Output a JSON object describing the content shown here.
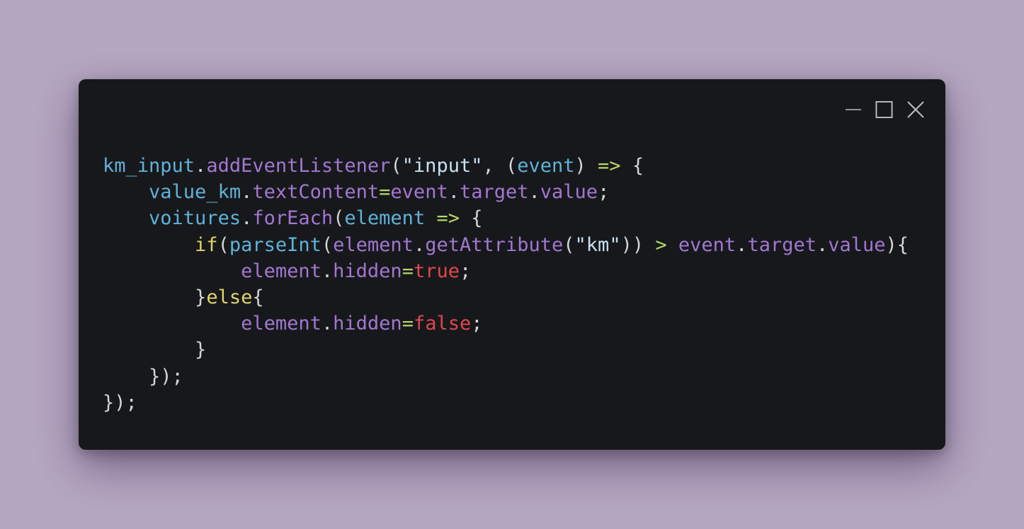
{
  "window": {
    "controls": [
      {
        "name": "minimize-icon"
      },
      {
        "name": "maximize-icon"
      },
      {
        "name": "close-icon"
      }
    ]
  },
  "colors": {
    "background": "#b5a6c1",
    "window_bg": "#17181b",
    "plain": "#d4d4d4",
    "variable": "#5fb3d9",
    "property": "#a277d1",
    "string": "#c8e0f2",
    "operator": "#b5d66a",
    "keyword": "#e2d36a",
    "boolean": "#e0474f"
  },
  "code": {
    "lines": [
      [
        {
          "text": "km_input",
          "kind": "variable"
        },
        {
          "text": ".",
          "kind": "plain"
        },
        {
          "text": "addEventListener",
          "kind": "property"
        },
        {
          "text": "(",
          "kind": "plain"
        },
        {
          "text": "\"input\"",
          "kind": "string"
        },
        {
          "text": ", (",
          "kind": "plain"
        },
        {
          "text": "event",
          "kind": "variable"
        },
        {
          "text": ") ",
          "kind": "plain"
        },
        {
          "text": "=>",
          "kind": "operator"
        },
        {
          "text": " {",
          "kind": "plain"
        }
      ],
      [
        {
          "text": "    ",
          "kind": "plain"
        },
        {
          "text": "value_km",
          "kind": "variable"
        },
        {
          "text": ".",
          "kind": "plain"
        },
        {
          "text": "textContent",
          "kind": "property"
        },
        {
          "text": "=",
          "kind": "operator"
        },
        {
          "text": "event",
          "kind": "property"
        },
        {
          "text": ".",
          "kind": "plain"
        },
        {
          "text": "target",
          "kind": "property"
        },
        {
          "text": ".",
          "kind": "plain"
        },
        {
          "text": "value",
          "kind": "property"
        },
        {
          "text": ";",
          "kind": "plain"
        }
      ],
      [
        {
          "text": "    ",
          "kind": "plain"
        },
        {
          "text": "voitures",
          "kind": "variable"
        },
        {
          "text": ".",
          "kind": "plain"
        },
        {
          "text": "forEach",
          "kind": "property"
        },
        {
          "text": "(",
          "kind": "plain"
        },
        {
          "text": "element",
          "kind": "variable"
        },
        {
          "text": " ",
          "kind": "plain"
        },
        {
          "text": "=>",
          "kind": "operator"
        },
        {
          "text": " {",
          "kind": "plain"
        }
      ],
      [
        {
          "text": "        ",
          "kind": "plain"
        },
        {
          "text": "if",
          "kind": "keyword"
        },
        {
          "text": "(",
          "kind": "plain"
        },
        {
          "text": "parseInt",
          "kind": "variable"
        },
        {
          "text": "(",
          "kind": "plain"
        },
        {
          "text": "element",
          "kind": "property"
        },
        {
          "text": ".",
          "kind": "plain"
        },
        {
          "text": "getAttribute",
          "kind": "property"
        },
        {
          "text": "(",
          "kind": "plain"
        },
        {
          "text": "\"km\"",
          "kind": "string"
        },
        {
          "text": ")) ",
          "kind": "plain"
        },
        {
          "text": ">",
          "kind": "operator"
        },
        {
          "text": " ",
          "kind": "plain"
        },
        {
          "text": "event",
          "kind": "property"
        },
        {
          "text": ".",
          "kind": "plain"
        },
        {
          "text": "target",
          "kind": "property"
        },
        {
          "text": ".",
          "kind": "plain"
        },
        {
          "text": "value",
          "kind": "property"
        },
        {
          "text": "){",
          "kind": "plain"
        }
      ],
      [
        {
          "text": "            ",
          "kind": "plain"
        },
        {
          "text": "element",
          "kind": "property"
        },
        {
          "text": ".",
          "kind": "plain"
        },
        {
          "text": "hidden",
          "kind": "property"
        },
        {
          "text": "=",
          "kind": "operator"
        },
        {
          "text": "true",
          "kind": "boolean"
        },
        {
          "text": ";",
          "kind": "plain"
        }
      ],
      [
        {
          "text": "        ",
          "kind": "plain"
        },
        {
          "text": "}",
          "kind": "plain"
        },
        {
          "text": "else",
          "kind": "keyword"
        },
        {
          "text": "{",
          "kind": "plain"
        }
      ],
      [
        {
          "text": "            ",
          "kind": "plain"
        },
        {
          "text": "element",
          "kind": "property"
        },
        {
          "text": ".",
          "kind": "plain"
        },
        {
          "text": "hidden",
          "kind": "property"
        },
        {
          "text": "=",
          "kind": "operator"
        },
        {
          "text": "false",
          "kind": "boolean"
        },
        {
          "text": ";",
          "kind": "plain"
        }
      ],
      [
        {
          "text": "        ",
          "kind": "plain"
        },
        {
          "text": "}",
          "kind": "plain"
        }
      ],
      [
        {
          "text": "    ",
          "kind": "plain"
        },
        {
          "text": "});",
          "kind": "plain"
        }
      ],
      [
        {
          "text": "});",
          "kind": "plain"
        }
      ]
    ]
  }
}
